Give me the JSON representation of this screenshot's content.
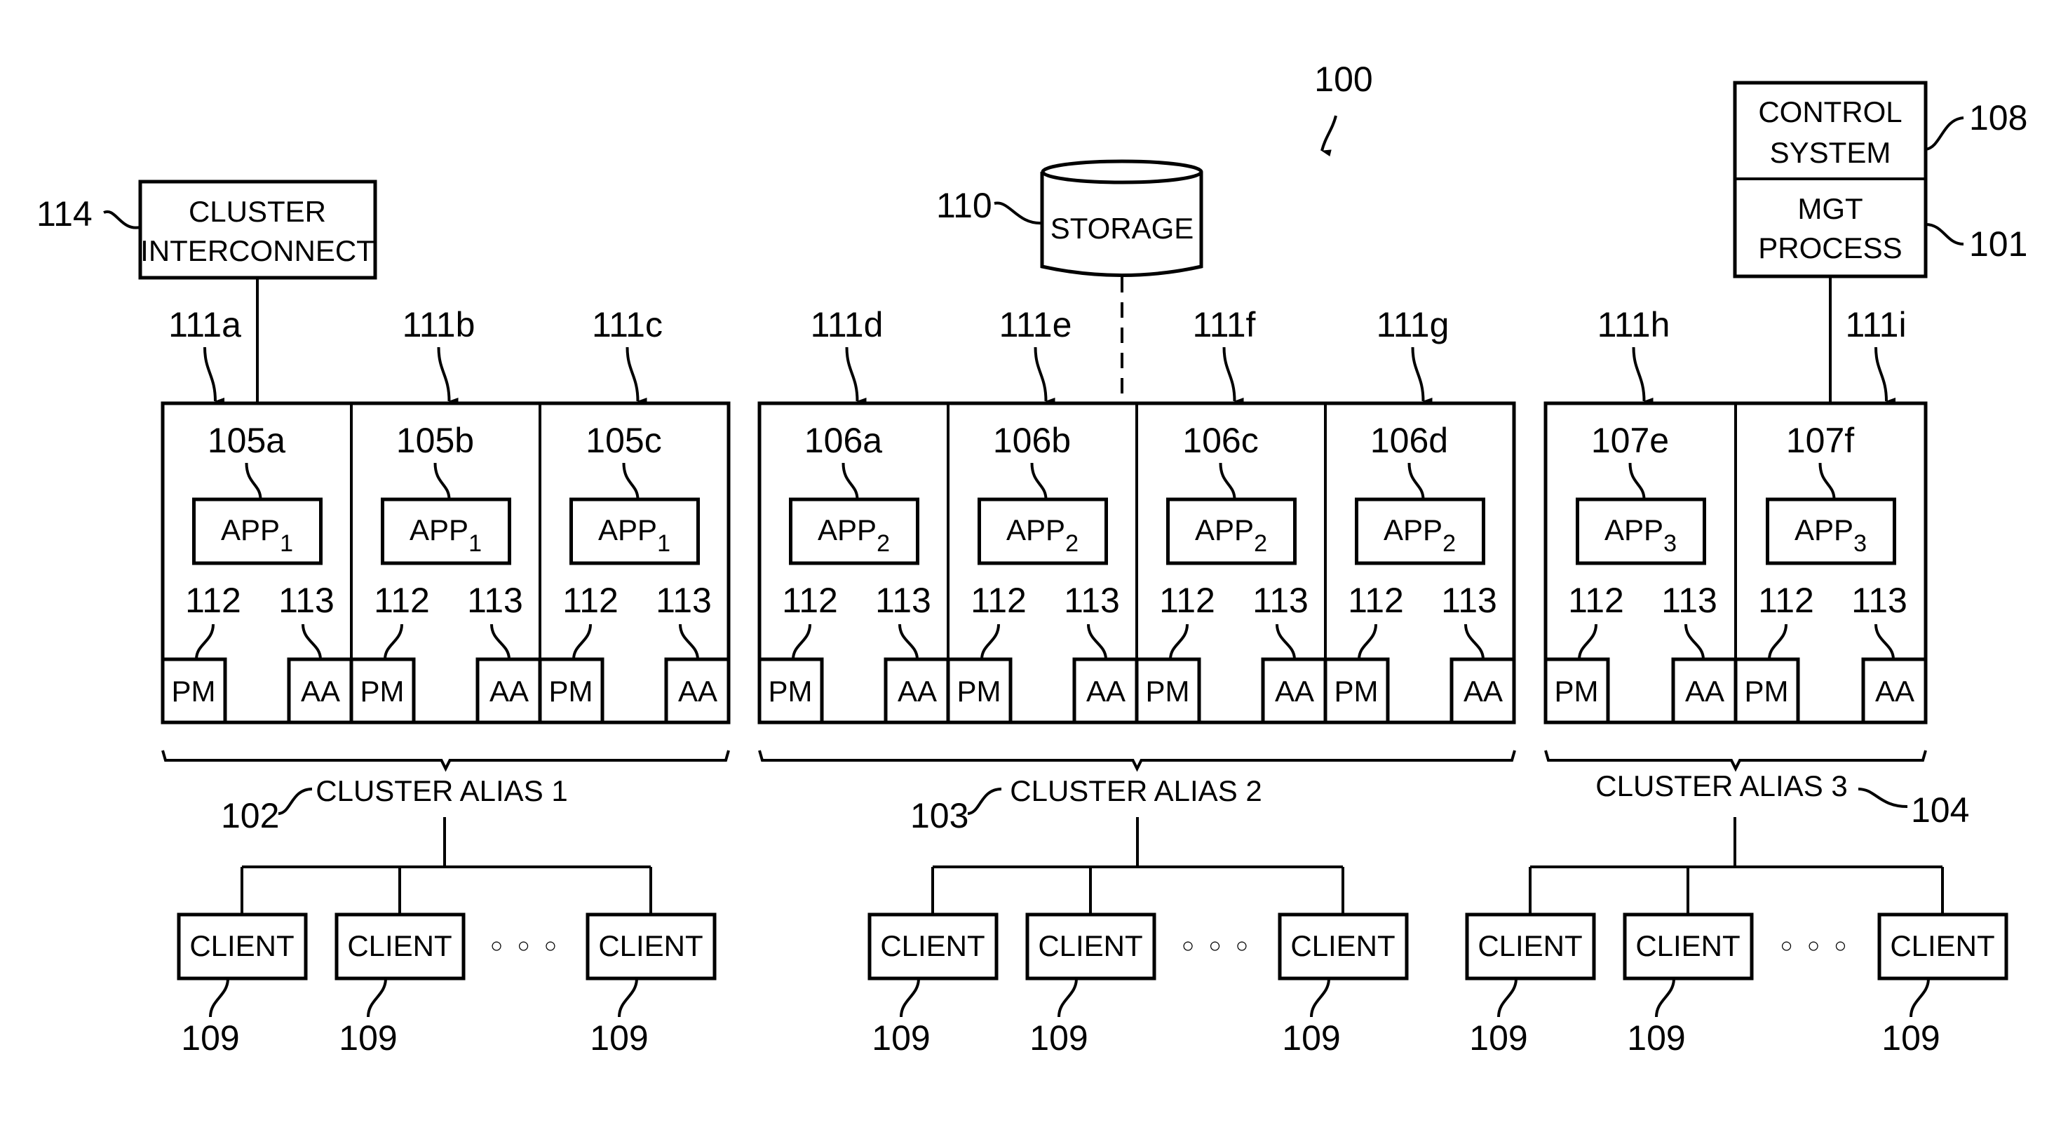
{
  "figure": {
    "ref": "100",
    "cluster_interconnect": {
      "ref": "114",
      "lines": [
        "CLUSTER",
        "INTERCONNECT"
      ]
    },
    "storage": {
      "ref": "110",
      "label": "STORAGE"
    },
    "control_system": {
      "ref": "108",
      "lines": [
        "CONTROL",
        "SYSTEM"
      ]
    },
    "mgt_process": {
      "ref": "101",
      "lines": [
        "MGT",
        "PROCESS"
      ]
    },
    "pm_ref": "112",
    "aa_ref": "113",
    "pm_label": "PM",
    "aa_label": "AA",
    "app_prefix": "APP",
    "clusters": [
      {
        "alias": "CLUSTER ALIAS 1",
        "alias_ref": "102",
        "nodes": [
          {
            "arrow_ref": "111a",
            "node_ref": "105a",
            "app_sub": "1"
          },
          {
            "arrow_ref": "111b",
            "node_ref": "105b",
            "app_sub": "1"
          },
          {
            "arrow_ref": "111c",
            "node_ref": "105c",
            "app_sub": "1"
          }
        ],
        "clients": [
          "CLIENT",
          "CLIENT",
          "CLIENT"
        ],
        "client_ref": "109"
      },
      {
        "alias": "CLUSTER ALIAS 2",
        "alias_ref": "103",
        "nodes": [
          {
            "arrow_ref": "111d",
            "node_ref": "106a",
            "app_sub": "2"
          },
          {
            "arrow_ref": "111e",
            "node_ref": "106b",
            "app_sub": "2"
          },
          {
            "arrow_ref": "111f",
            "node_ref": "106c",
            "app_sub": "2"
          },
          {
            "arrow_ref": "111g",
            "node_ref": "106d",
            "app_sub": "2"
          }
        ],
        "clients": [
          "CLIENT",
          "CLIENT",
          "CLIENT"
        ],
        "client_ref": "109"
      },
      {
        "alias": "CLUSTER ALIAS 3",
        "alias_ref": "104",
        "nodes": [
          {
            "arrow_ref": "111h",
            "node_ref": "107e",
            "app_sub": "3"
          },
          {
            "arrow_ref": "111i",
            "node_ref": "107f",
            "app_sub": "3"
          }
        ],
        "clients": [
          "CLIENT",
          "CLIENT",
          "CLIENT"
        ],
        "client_ref": "109"
      }
    ],
    "ellipsis": "○ ○ ○"
  }
}
